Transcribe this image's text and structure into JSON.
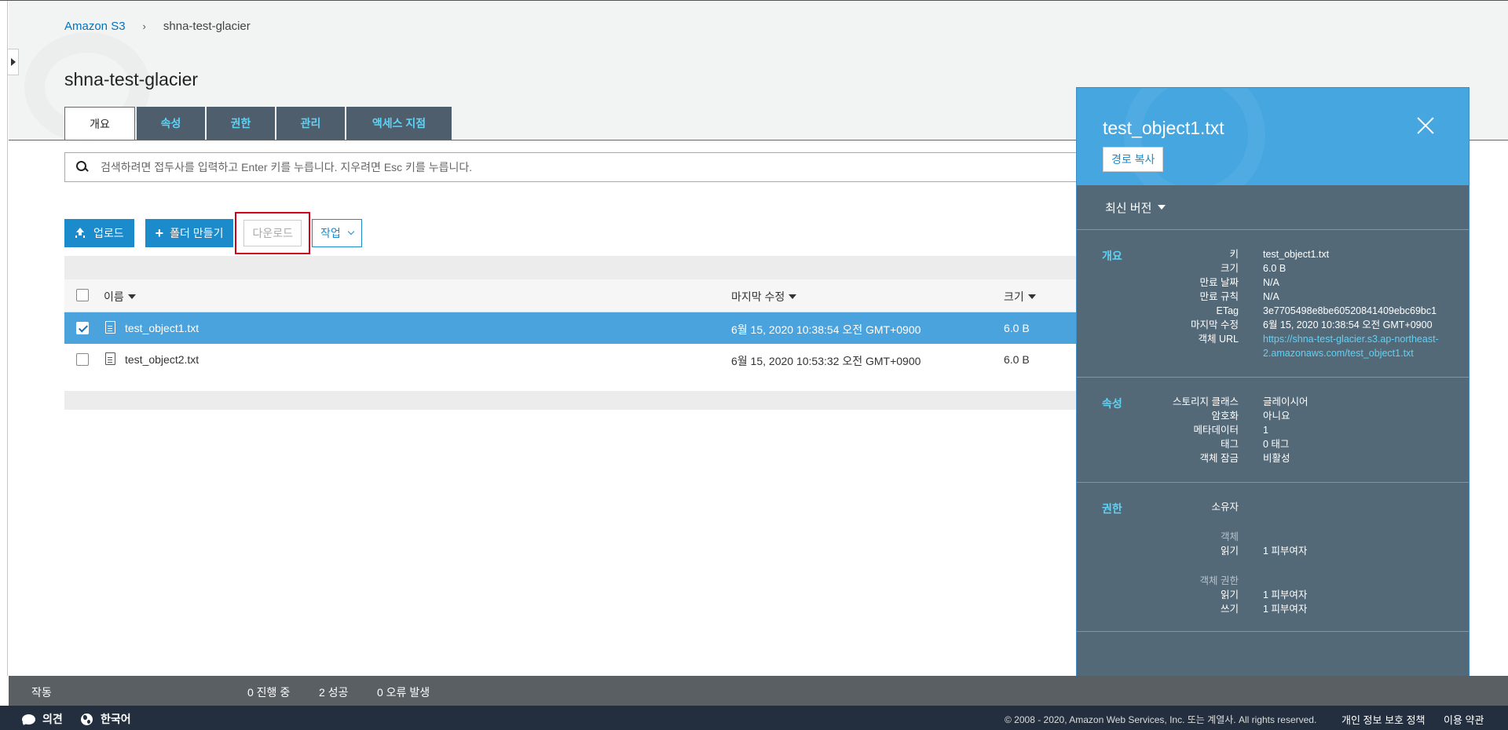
{
  "breadcrumb": {
    "root": "Amazon S3",
    "separator": "›",
    "current": "shna-test-glacier"
  },
  "page_title": "shna-test-glacier",
  "tabs": [
    {
      "label": "개요",
      "active": true
    },
    {
      "label": "속성"
    },
    {
      "label": "권한"
    },
    {
      "label": "관리"
    },
    {
      "label": "액세스 지점"
    }
  ],
  "search": {
    "placeholder": "검색하려면 접두사를 입력하고 Enter 키를 누릅니다. 지우려면 Esc 키를 누릅니다.",
    "value": ""
  },
  "toolbar": {
    "upload": "업로드",
    "create_folder": "폴더 만들기",
    "download": "다운로드",
    "actions": "작업"
  },
  "table": {
    "columns": {
      "name": "이름",
      "modified": "마지막 수정",
      "size": "크기"
    },
    "rows": [
      {
        "name": "test_object1.txt",
        "modified": "6월 15, 2020 10:38:54 오전 GMT+0900",
        "size": "6.0 B",
        "selected": true
      },
      {
        "name": "test_object2.txt",
        "modified": "6월 15, 2020 10:53:32 오전 GMT+0900",
        "size": "6.0 B",
        "selected": false
      }
    ]
  },
  "panel": {
    "title": "test_object1.txt",
    "copy_path": "경로 복사",
    "version": "최신 버전",
    "overview": {
      "title": "개요",
      "key_label": "키",
      "key": "test_object1.txt",
      "size_label": "크기",
      "size": "6.0 B",
      "expiry_date_label": "만료 날짜",
      "expiry_date": "N/A",
      "expiry_rule_label": "만료 규칙",
      "expiry_rule": "N/A",
      "etag_label": "ETag",
      "etag": "3e7705498e8be60520841409ebc69bc1",
      "modified_label": "마지막 수정",
      "modified": "6월 15, 2020 10:38:54 오전 GMT+0900",
      "url_label": "객체 URL",
      "url_line1": "https://shna-test-glacier.s3.ap-northeast-",
      "url_line2": "2.amazonaws.com/test_object1.txt"
    },
    "properties": {
      "title": "속성",
      "storage_class_label": "스토리지 클래스",
      "storage_class": "글레이시어",
      "encryption_label": "암호화",
      "encryption": "아니요",
      "metadata_label": "메타데이터",
      "metadata": "1",
      "tags_label": "태그",
      "tags": "0 태그",
      "lock_label": "객체 잠금",
      "lock": "비활성"
    },
    "permissions": {
      "title": "권한",
      "owner_label": "소유자",
      "object_label": "객체",
      "read_label": "읽기",
      "read": "1 피부여자",
      "acl_label": "객체 권한",
      "acl_read_label": "읽기",
      "acl_read": "1 피부여자",
      "acl_write_label": "쓰기",
      "acl_write": "1 피부여자"
    }
  },
  "status": {
    "label": "작동",
    "in_progress": "0 진행 중",
    "success": "2 성공",
    "errors": "0 오류 발생"
  },
  "footer": {
    "feedback": "의견",
    "language": "한국어",
    "copyright": "© 2008 - 2020, Amazon Web Services, Inc. 또는 계열사. All rights reserved.",
    "privacy": "개인 정보 보호 정책",
    "terms": "이용 약관"
  }
}
